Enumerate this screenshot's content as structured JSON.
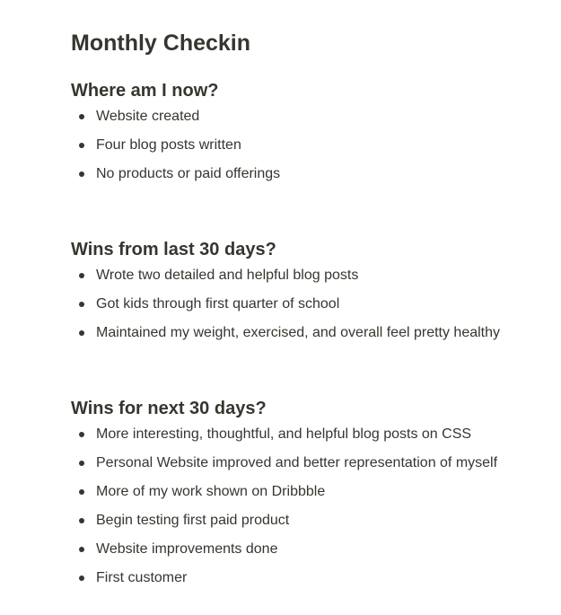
{
  "page_title": "Monthly Checkin",
  "sections": [
    {
      "heading": "Where am I now?",
      "items": [
        "Website created",
        "Four blog posts written",
        "No products or paid offerings"
      ]
    },
    {
      "heading": "Wins from last 30 days?",
      "items": [
        "Wrote two detailed and helpful blog posts",
        "Got kids through first quarter of school",
        "Maintained my weight, exercised, and overall feel pretty healthy"
      ]
    },
    {
      "heading": "Wins for next 30 days?",
      "items": [
        "More interesting, thoughtful, and helpful blog posts on CSS",
        "Personal Website improved and better representation of myself",
        "More of my work shown on Dribbble",
        "Begin testing first paid product",
        "Website improvements done",
        "First customer"
      ]
    }
  ]
}
